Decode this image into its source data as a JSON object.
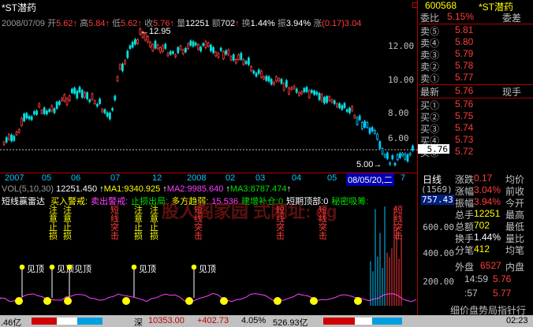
{
  "header": {
    "title": "*ST潜药",
    "date": "2008/07/09",
    "open_label": "开",
    "open": "5.62",
    "high_label": "高",
    "high": "5.84",
    "low_label": "低",
    "low": "5.62",
    "close_label": "收",
    "close": "5.76",
    "vol_label": "量",
    "vol": "12251",
    "amount_label": "额",
    "amount": "702",
    "turnover_label": "换",
    "turnover": "1.44%",
    "amplitude_label": "振",
    "amplitude": "3.94%",
    "change_label": "涨",
    "change": "(0.17)3.04"
  },
  "price_chart": {
    "high_mark": "12.95",
    "low_mark": "5.00",
    "current_badge": "5.76",
    "y_ticks": [
      "12.00",
      "10.00",
      "8.00",
      "6.00"
    ],
    "x_ticks": [
      "2007",
      "05",
      "06",
      "07",
      "12",
      "2008",
      "02",
      "03",
      "04",
      "05"
    ],
    "cursor_date": "08/05/20,二",
    "cursor_extra": "7",
    "period_label": "日线"
  },
  "vol_panel": {
    "title": "VOL(5,10,30)",
    "value": "12251.450",
    "ma1": "MA1:9340.925",
    "ma2": "MA2:9985.640",
    "ma3": "MA3:8787.474",
    "right_value": "(1569)",
    "right_value2": "757.43"
  },
  "indicator": {
    "name": "短线赢雷达",
    "legend": [
      {
        "text": "买入警戒:",
        "color": "#ffff00"
      },
      {
        "text": "卖出警戒:",
        "color": "#ff40ff"
      },
      {
        "text": "止损出局:",
        "color": "#00e000"
      },
      {
        "text": "多方趋弱:",
        "color": "#ffff00"
      },
      {
        "text": "15.536",
        "color": "#ff40ff"
      },
      {
        "text": "建增补仓:0",
        "color": "#00e000"
      },
      {
        "text": "短期顶部:0",
        "color": "#ffffff"
      },
      {
        "text": "秘密吸筹:",
        "color": "#00e000"
      }
    ],
    "y_ticks": [
      "600.00",
      "400.00",
      "200.00"
    ],
    "watermark": "股人阁家园 式网址: gg",
    "signals": [
      {
        "text": "注意止损",
        "color": "#ffff00"
      },
      {
        "text": "注意止损",
        "color": "#ffff00"
      },
      {
        "text": "短线突击",
        "color": "#ff3c3c"
      },
      {
        "text": "注意止损",
        "color": "#ffff00"
      },
      {
        "text": "注意止损",
        "color": "#ffff00"
      },
      {
        "text": "短线突击",
        "color": "#ff3c3c"
      },
      {
        "text": "短线突击",
        "color": "#ff3c3c"
      },
      {
        "text": "短线突击",
        "color": "#ff3c3c"
      },
      {
        "text": "短线突击",
        "color": "#ff3c3c"
      }
    ],
    "top_marks": [
      "见顶",
      "见顶",
      "见顶",
      "见顶",
      "见顶"
    ]
  },
  "side": {
    "code": "600568",
    "name": "*ST潜药",
    "ratio_label": "委比",
    "ratio": "5.15%",
    "diff_label": "委差",
    "asks": [
      {
        "label": "卖⑤",
        "price": "5.81"
      },
      {
        "label": "卖④",
        "price": "5.80"
      },
      {
        "label": "卖③",
        "price": "5.79"
      },
      {
        "label": "卖②",
        "price": "5.78"
      },
      {
        "label": "卖①",
        "price": "5.77"
      }
    ],
    "last_label": "最新",
    "last": "5.76",
    "hand_label": "现手",
    "bids": [
      {
        "label": "买①",
        "price": "5.76"
      },
      {
        "label": "买②",
        "price": "5.75"
      },
      {
        "label": "买③",
        "price": "5.74"
      },
      {
        "label": "买④",
        "price": "5.73"
      },
      {
        "label": "买⑤",
        "price": "5.72"
      }
    ],
    "stats": [
      {
        "l1": "涨跌",
        "v1": "0.17",
        "l2": "均价",
        "v2": ""
      },
      {
        "l1": "涨幅",
        "v1": "3.04%",
        "l2": "前收",
        "v2": ""
      },
      {
        "l1": "振幅",
        "v1": "3.94%",
        "l2": "今开",
        "v2": ""
      },
      {
        "l1": "总手",
        "v1": "12251",
        "l2": "最高",
        "v2": ""
      },
      {
        "l1": "总额",
        "v1": "702",
        "l2": "最低",
        "v2": ""
      },
      {
        "l1": "换手",
        "v1": "1.44%",
        "l2": "量比",
        "v2": ""
      },
      {
        "l1": "分笔",
        "v1": "412",
        "l2": "均笔",
        "v2": ""
      }
    ],
    "outer_label": "外盘",
    "outer": "6527",
    "inner_label": "内盘",
    "ticks": [
      {
        "time": "14:59",
        "price": "5.76"
      },
      {
        "time": ":57",
        "price": "5.77"
      }
    ],
    "footer": "细价盘势局指针行版"
  },
  "statusbar": {
    "left": ".46亿",
    "market": "深",
    "index": "10353.00",
    "delta": "+402.73",
    "pct": "4.05%",
    "amount": "526.93亿",
    "time": "02:23"
  }
}
